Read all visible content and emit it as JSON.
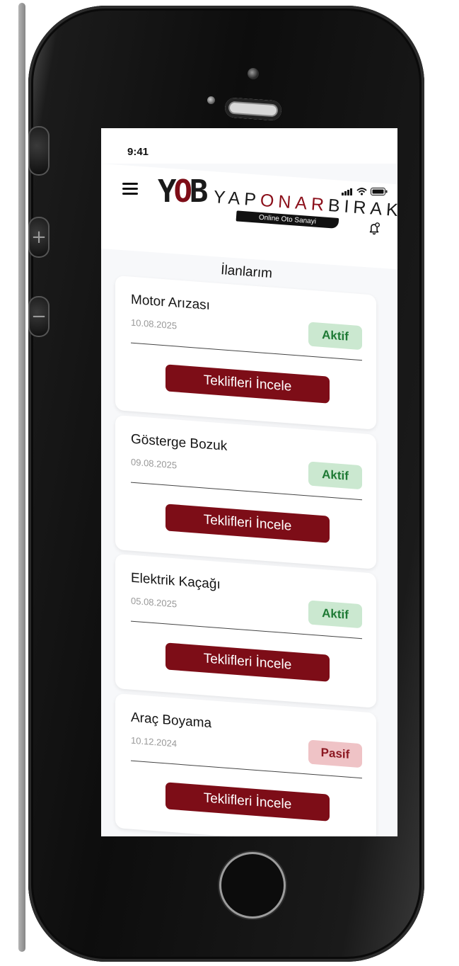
{
  "status_bar": {
    "time": "9:41"
  },
  "header": {
    "logo_mark": [
      "Y",
      "O",
      "B"
    ],
    "brand_parts": [
      "YAP",
      "ONAR",
      "BIRAK"
    ],
    "tagline": "Online Oto Sanayi",
    "menu_icon": "hamburger-menu-icon",
    "notification_icon": "bell-icon"
  },
  "page": {
    "title": "İlanlarım"
  },
  "listings": [
    {
      "title": "Motor Arızası",
      "date": "10.08.2025",
      "status": "Aktif",
      "button": "Teklifleri İncele"
    },
    {
      "title": "Gösterge Bozuk",
      "date": "09.08.2025",
      "status": "Aktif",
      "button": "Teklifleri İncele"
    },
    {
      "title": "Elektrik Kaçağı",
      "date": "05.08.2025",
      "status": "Aktif",
      "button": "Teklifleri İncele"
    },
    {
      "title": "Araç Boyama",
      "date": "10.12.2024",
      "status": "Pasif",
      "button": "Teklifleri İncele"
    }
  ],
  "colors": {
    "brand": "#7d0d17",
    "active_bg": "#cbe8d0",
    "active_text": "#1f7a35",
    "passive_bg": "#efc3c6",
    "passive_text": "#8c1822"
  }
}
